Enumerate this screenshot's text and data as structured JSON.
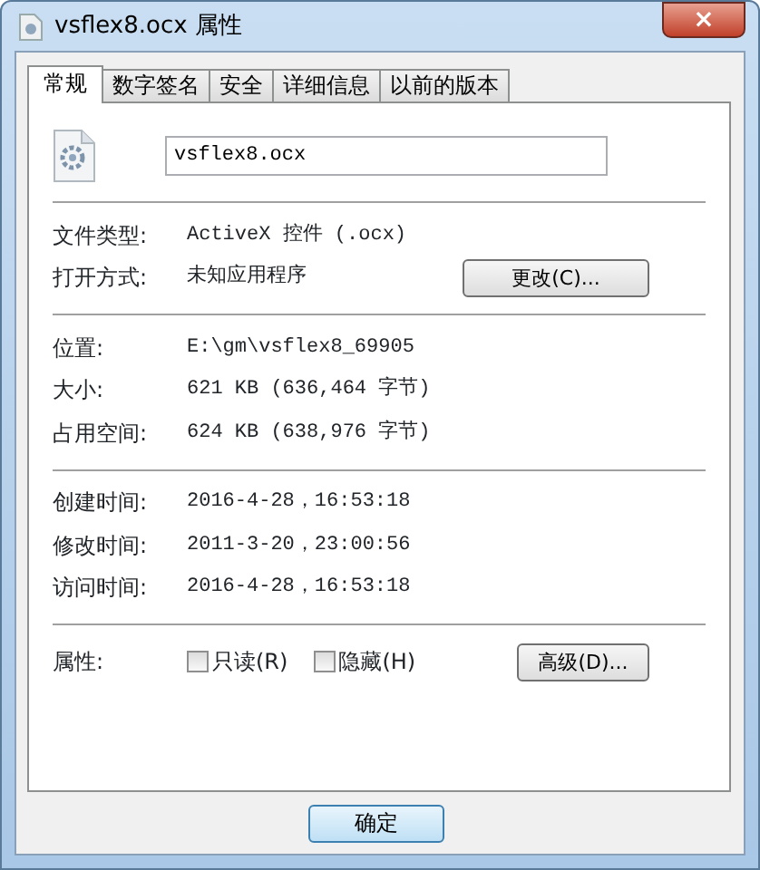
{
  "window": {
    "title": "vsflex8.ocx 属性",
    "close": "×"
  },
  "tabs": [
    {
      "label": "常规",
      "selected": true
    },
    {
      "label": "数字签名",
      "selected": false
    },
    {
      "label": "安全",
      "selected": false
    },
    {
      "label": "详细信息",
      "selected": false
    },
    {
      "label": "以前的版本",
      "selected": false
    }
  ],
  "file_name": {
    "value": "vsflex8.ocx"
  },
  "sections": [
    [
      {
        "label": "文件类型:",
        "value": "ActiveX 控件 (.ocx)"
      },
      {
        "label": "打开方式:",
        "value": "未知应用程序",
        "button": "更改(C)..."
      }
    ],
    [
      {
        "label": "位置:",
        "value": "E:\\gm\\vsflex8_69905"
      },
      {
        "label": "大小:",
        "value": "621 KB (636,464 字节)"
      },
      {
        "label": "占用空间:",
        "value": "624 KB (638,976 字节)"
      }
    ],
    [
      {
        "label": "创建时间:",
        "value": "2016-4-28，16:53:18"
      },
      {
        "label": "修改时间:",
        "value": "2011-3-20，23:00:56"
      },
      {
        "label": "访问时间:",
        "value": "2016-4-28，16:53:18"
      }
    ]
  ],
  "attributes": {
    "label": "属性:",
    "checkboxes": [
      {
        "label": "只读(R)",
        "checked": false
      },
      {
        "label": "隐藏(H)",
        "checked": false
      }
    ],
    "button": "高级(D)..."
  },
  "buttons": [
    "确定"
  ]
}
